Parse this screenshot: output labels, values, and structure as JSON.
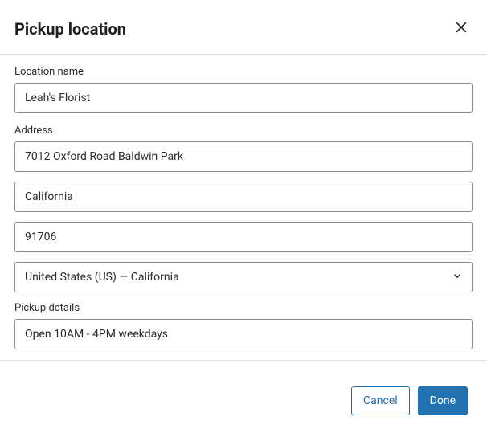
{
  "header": {
    "title": "Pickup location"
  },
  "form": {
    "locationName": {
      "label": "Location name",
      "value": "Leah's Florist"
    },
    "address": {
      "label": "Address",
      "street": "7012 Oxford Road Baldwin Park",
      "city": "California",
      "zip": "91706",
      "region": "United States (US) — California"
    },
    "pickupDetails": {
      "label": "Pickup details",
      "value": "Open 10AM - 4PM weekdays"
    }
  },
  "footer": {
    "cancel": "Cancel",
    "done": "Done"
  }
}
